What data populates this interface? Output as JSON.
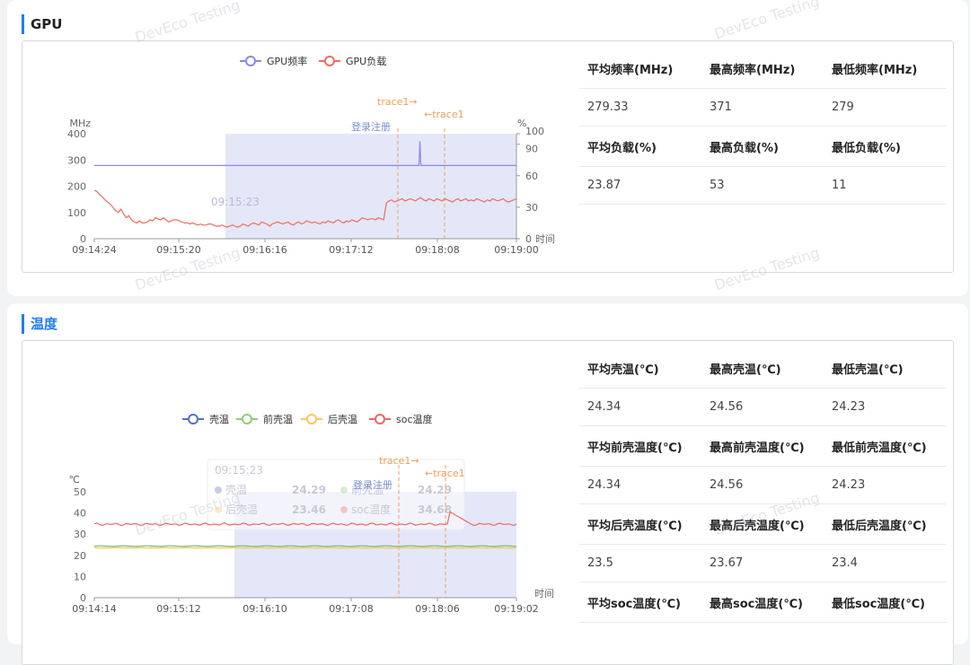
{
  "watermark": "DevEco Testing",
  "gpu": {
    "title": "GPU",
    "chart_data": {
      "type": "line",
      "legend": [
        "GPU频率",
        "GPU负载"
      ],
      "colors": [
        "#8c88e8",
        "#ef6d5f"
      ],
      "left_unit": "MHz",
      "right_unit": "%",
      "x_unit": "时间",
      "left_ticks": [
        "400",
        "300",
        "200",
        "100",
        "0"
      ],
      "right_ticks": [
        "100",
        "90",
        "60",
        "30",
        "0"
      ],
      "x_ticks": [
        "09:14:24",
        "09:15:20",
        "09:16:16",
        "09:17:12",
        "09:18:08",
        "09:19:00"
      ],
      "ylim_left": [
        0,
        400
      ],
      "ylim_right": [
        0,
        100
      ],
      "series": [
        {
          "name": "GPU频率",
          "axis": "left",
          "values": [
            279,
            279,
            279,
            279,
            279,
            279,
            279,
            279,
            279,
            279,
            279,
            279,
            279,
            279,
            279,
            279,
            279,
            279,
            279,
            279,
            279,
            279,
            279,
            279,
            279,
            279,
            279,
            279,
            279,
            279,
            279,
            279,
            279,
            279,
            279,
            279,
            279,
            279,
            279,
            279,
            279,
            279,
            279,
            279,
            279,
            279,
            279,
            279,
            279,
            279,
            279,
            279,
            279,
            279,
            279,
            279,
            279,
            279,
            279,
            279,
            279,
            279,
            279,
            279,
            279,
            279,
            279,
            279,
            279,
            279,
            279,
            279,
            279,
            279,
            279,
            279,
            279,
            279,
            279,
            279,
            279,
            279,
            279,
            279,
            279,
            279,
            279,
            279,
            279,
            279,
            279,
            279,
            279,
            279,
            279,
            279,
            279,
            279,
            279,
            279,
            279,
            279,
            279,
            279,
            279,
            279,
            279,
            279,
            279,
            279,
            279,
            279,
            279,
            279,
            279,
            279,
            279,
            279,
            279,
            279,
            279,
            279,
            279,
            279,
            279,
            279,
            279,
            279,
            279,
            279,
            279,
            279,
            279,
            279,
            279,
            279,
            279,
            279,
            279,
            279,
            279,
            279,
            279,
            279,
            279,
            279,
            279,
            279,
            279,
            279,
            279,
            279,
            279,
            279,
            279,
            279,
            279,
            279,
            279,
            279,
            279,
            279,
            279,
            279,
            279,
            279,
            279,
            279,
            279,
            279,
            279,
            279,
            279,
            279,
            279,
            279,
            279,
            279,
            279,
            279,
            279,
            279,
            279,
            279,
            279,
            279,
            279,
            279,
            279,
            279,
            279,
            279,
            279,
            279,
            279,
            279,
            279,
            279,
            279,
            279,
            279,
            279,
            279,
            279,
            279,
            279,
            279,
            279,
            279,
            279,
            279,
            279,
            279,
            279,
            279,
            279,
            279,
            279,
            279,
            279,
            279,
            279,
            279,
            279,
            279,
            279,
            279,
            279,
            279,
            279,
            279,
            279,
            279,
            279,
            279,
            279,
            279,
            279,
            279,
            279,
            279,
            279,
            279,
            279,
            279,
            279,
            279,
            279,
            279,
            279,
            279,
            279,
            279,
            279,
            279,
            279,
            279,
            279,
            279,
            279,
            279,
            279,
            279,
            279,
            279,
            279,
            279,
            279,
            279,
            279,
            279,
            279,
            279,
            279,
            279,
            279,
            279,
            279,
            279,
            279,
            279,
            279,
            279,
            279,
            279,
            279,
            279,
            279,
            279,
            279,
            279,
            279,
            279,
            279,
            279,
            279,
            279,
            279,
            279,
            279,
            279,
            279,
            279,
            279,
            279,
            279,
            279,
            279,
            279,
            279,
            279,
            279,
            279,
            279,
            279,
            279,
            279,
            279,
            279,
            279,
            279,
            279,
            279,
            279,
            279,
            279,
            279,
            279,
            279,
            279,
            279,
            279,
            279,
            279,
            371,
            279,
            279,
            279,
            279,
            279,
            279,
            279,
            279,
            279,
            279,
            279,
            279,
            279,
            279,
            279,
            279,
            279,
            279,
            279,
            279,
            279,
            279,
            279,
            279,
            279,
            279,
            279,
            279,
            279,
            279,
            279,
            279,
            279,
            279,
            279,
            279,
            279,
            279,
            279,
            279,
            279,
            279,
            279,
            279,
            279,
            279,
            279,
            279,
            279,
            279,
            279,
            279,
            279,
            279,
            279,
            279,
            279,
            279,
            279,
            279,
            279,
            279,
            279,
            279,
            279,
            279,
            279,
            279,
            279,
            279,
            279,
            279,
            279,
            279,
            279,
            279,
            279,
            279,
            279,
            279,
            279,
            279,
            279,
            279,
            279,
            279,
            279,
            279,
            279,
            279,
            279,
            279,
            279,
            279,
            279,
            279,
            279,
            279,
            279
          ]
        },
        {
          "name": "GPU负载",
          "axis": "right",
          "values": [
            46,
            45,
            42,
            40,
            37,
            35,
            33,
            30,
            27,
            25,
            28,
            24,
            20,
            22,
            18,
            16,
            15,
            17,
            15,
            15,
            16,
            18,
            17,
            20,
            19,
            18,
            20,
            18,
            16,
            17,
            18,
            18,
            17,
            16,
            15,
            15,
            14,
            15,
            14,
            13,
            14,
            13,
            13,
            14,
            14,
            13,
            12,
            12,
            13,
            12,
            11,
            12,
            13,
            12,
            11,
            12,
            14,
            13,
            12,
            14,
            15,
            14,
            13,
            16,
            15,
            14,
            12,
            14,
            15,
            16,
            15,
            14,
            15,
            16,
            14,
            13,
            15,
            16,
            14,
            15,
            17,
            16,
            15,
            16,
            15,
            14,
            16,
            15,
            17,
            16,
            15,
            17,
            18,
            16,
            15,
            17,
            16,
            18,
            17,
            16,
            18,
            20,
            19,
            18,
            19,
            19,
            18,
            20,
            19,
            18,
            34,
            36,
            37,
            35,
            36,
            37,
            38,
            36,
            37,
            38,
            37,
            36,
            38,
            39,
            37,
            36,
            38,
            37,
            36,
            38,
            37,
            36,
            38,
            37,
            36,
            35,
            37,
            38,
            36,
            37,
            38,
            36,
            37,
            36,
            38,
            37,
            36,
            35,
            37,
            36,
            38,
            37,
            36,
            37,
            38,
            36,
            35,
            36,
            37,
            38
          ]
        }
      ]
    },
    "markers": {
      "trace1_start": "trace1→",
      "trace1_end": "←trace1",
      "login": "登录注册",
      "ghost_time": "09:15:23"
    },
    "stats": {
      "rows": [
        {
          "headers": [
            "平均频率(MHz)",
            "最高频率(MHz)",
            "最低频率(MHz)"
          ],
          "values": [
            "279.33",
            "371",
            "279"
          ]
        },
        {
          "headers": [
            "平均负载(%)",
            "最高负载(%)",
            "最低负载(%)"
          ],
          "values": [
            "23.87",
            "53",
            "11"
          ]
        }
      ]
    }
  },
  "temp": {
    "title": "温度",
    "chart_data": {
      "type": "line",
      "legend": [
        "壳温",
        "前壳温",
        "后壳温",
        "soc温度"
      ],
      "colors": [
        "#5470c6",
        "#91cc75",
        "#fac858",
        "#ee6666"
      ],
      "y_unit": "℃",
      "x_unit": "时间",
      "y_ticks": [
        "50",
        "40",
        "30",
        "20",
        "10",
        "0"
      ],
      "x_ticks": [
        "09:14:14",
        "09:15:12",
        "09:16:10",
        "09:17:08",
        "09:18:06",
        "09:19:02"
      ],
      "ylim": [
        0,
        50
      ],
      "series": [
        {
          "name": "壳温",
          "level": 24.34
        },
        {
          "name": "前壳温",
          "level": 24.34
        },
        {
          "name": "后壳温",
          "level": 23.5
        },
        {
          "name": "soc温度",
          "level": 34.68,
          "peak": 40.5
        }
      ]
    },
    "markers": {
      "trace1_start": "trace1→",
      "trace1_end": "←trace1",
      "login": "登录注册"
    },
    "tooltip": {
      "time": "09:15:23",
      "items": [
        {
          "label": "壳温",
          "value": "24.29"
        },
        {
          "label": "前壳温",
          "value": "24.29"
        },
        {
          "label": "后壳温",
          "value": "23.46"
        },
        {
          "label": "soc温度",
          "value": "34.68"
        }
      ]
    },
    "stats": {
      "rows": [
        {
          "headers": [
            "平均壳温(℃)",
            "最高壳温(℃)",
            "最低壳温(℃)"
          ],
          "values": [
            "24.34",
            "24.56",
            "24.23"
          ]
        },
        {
          "headers": [
            "平均前壳温度(℃)",
            "最高前壳温度(℃)",
            "最低前壳温度(℃)"
          ],
          "values": [
            "24.34",
            "24.56",
            "24.23"
          ]
        },
        {
          "headers": [
            "平均后壳温度(℃)",
            "最高后壳温度(℃)",
            "最低后壳温度(℃)"
          ],
          "values": [
            "23.5",
            "23.67",
            "23.4"
          ]
        },
        {
          "headers": [
            "平均soc温度(℃)",
            "最高soc温度(℃)",
            "最低soc温度(℃)"
          ],
          "values": []
        }
      ]
    }
  }
}
